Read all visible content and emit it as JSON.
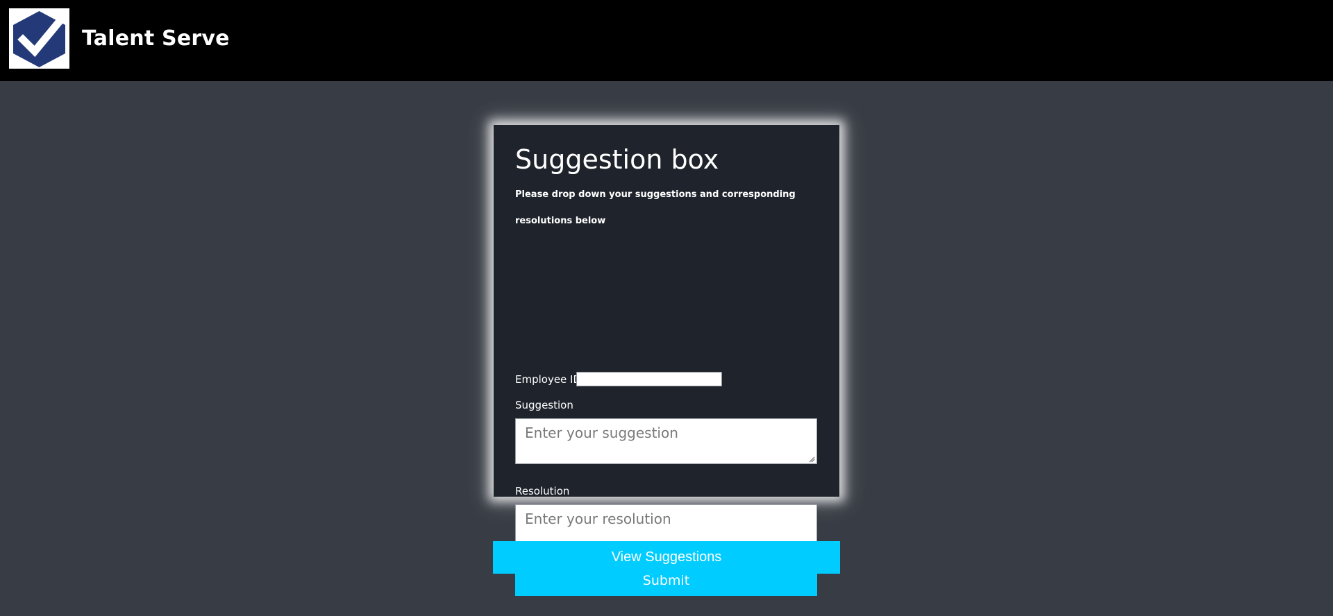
{
  "header": {
    "app_name": "Talent Serve",
    "logo_icon": "check-shield-icon"
  },
  "colors": {
    "topbar": "#000000",
    "page_background": "#383d45",
    "card_background": "#1f242c",
    "accent": "#00ccff",
    "logo_blue": "#243a78"
  },
  "form": {
    "title": "Suggestion box",
    "description": "Please drop down your suggestions and corresponding resolutions below",
    "employee_id_label": "Employee ID",
    "employee_id_value": "",
    "suggestion_label": "Suggestion",
    "suggestion_placeholder": "Enter your suggestion",
    "resolution_label": "Resolution",
    "resolution_placeholder": "Enter your resolution",
    "submit_label": "Submit"
  },
  "view_suggestions_label": "View Suggestions"
}
